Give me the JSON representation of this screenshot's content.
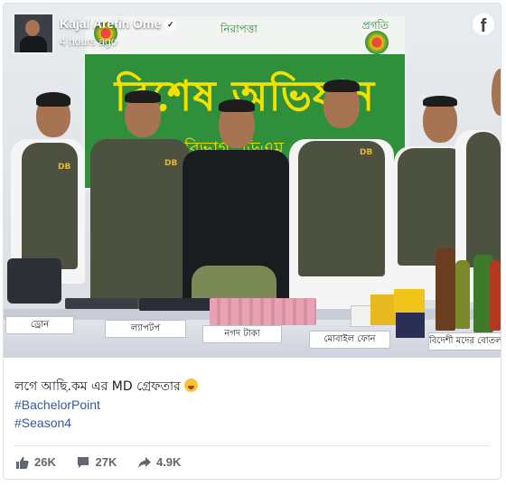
{
  "post": {
    "author": "Kajal Arefin Ome",
    "timestamp": "4 hours ago",
    "caption": "লগে আছি.কম এর MD গ্রেফতার",
    "hashtags": [
      "#BachelorPoint",
      "#Season4"
    ]
  },
  "photo": {
    "banner_title": "বিশেষ অভিযান",
    "banner_top_mid": "নিরাপত্তা",
    "banner_top_right": "প্রগতি",
    "banner_sub": "বিভাগ, ডিএম",
    "badge_text": "DB",
    "table_tags": [
      "ড্রোন",
      "ল্যাপটপ",
      "নগদ টাকা",
      "মোবাইল ফোন",
      "বিদেশী মদের বোতল"
    ]
  },
  "reactions": {
    "likes": "26K",
    "comments": "27K",
    "shares": "4.9K"
  },
  "icons": {
    "brand": "facebook-logo-icon",
    "like": "thumbs-up-icon",
    "comment": "comment-bubble-icon",
    "share": "share-arrow-icon"
  },
  "colors": {
    "hashtag": "#365899",
    "banner_green": "#2f8f3a",
    "banner_text": "#f2e000"
  }
}
